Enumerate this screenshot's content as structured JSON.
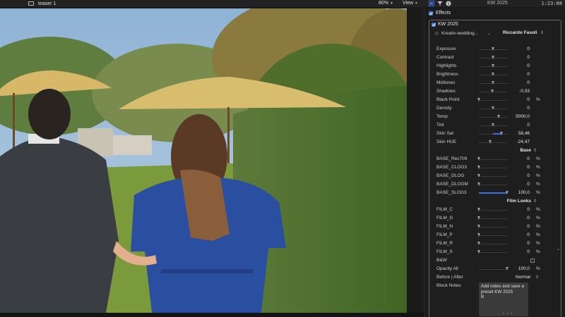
{
  "topbar": {
    "clip_title": "teaser 1",
    "zoom": "80%",
    "view_label": "View",
    "inspector_title": "KW 2025",
    "timecode": "1:23:08"
  },
  "inspector": {
    "section_label": "Effects",
    "effect_name": "KW 2025",
    "preset_name": "Kreativ-wedding...",
    "preset_author": "Riccardo Fasoli",
    "params_basic": [
      {
        "label": "Exposure",
        "value": "0",
        "unit": "",
        "pos": 0.5
      },
      {
        "label": "Contrast",
        "value": "0",
        "unit": "",
        "pos": 0.5
      },
      {
        "label": "Highlights",
        "value": "0",
        "unit": "",
        "pos": 0.5
      },
      {
        "label": "Brightness",
        "value": "0",
        "unit": "",
        "pos": 0.5
      },
      {
        "label": "Midtones",
        "value": "0",
        "unit": "",
        "pos": 0.5
      },
      {
        "label": "Shadows",
        "value": "-0,33",
        "unit": "",
        "pos": 0.48
      },
      {
        "label": "Black Point",
        "value": "0",
        "unit": "%",
        "pos": 0.0
      },
      {
        "label": "Density",
        "value": "0",
        "unit": "",
        "pos": 0.5
      },
      {
        "label": "Temp",
        "value": "5000,0",
        "unit": "",
        "pos": 0.7
      },
      {
        "label": "Tint",
        "value": "0",
        "unit": "",
        "pos": 0.5
      },
      {
        "label": "Skin Sat",
        "value": "58,46",
        "unit": "",
        "pos": 0.8,
        "fill": true
      },
      {
        "label": "Skin HUE",
        "value": "-24,47",
        "unit": "",
        "pos": 0.4
      }
    ],
    "base_section": "Base",
    "params_base": [
      {
        "label": "BASE_Rec709",
        "value": "0",
        "unit": "%",
        "pos": 0.0
      },
      {
        "label": "BASE_CLOG3",
        "value": "0",
        "unit": "%",
        "pos": 0.0
      },
      {
        "label": "BASE_DLOG",
        "value": "0",
        "unit": "%",
        "pos": 0.0
      },
      {
        "label": "BASE_DLOGM",
        "value": "0",
        "unit": "%",
        "pos": 0.0
      },
      {
        "label": "BASE_SLOG3",
        "value": "100,0",
        "unit": "%",
        "pos": 1.0,
        "fill": true
      }
    ],
    "film_section": "Film Looks",
    "params_film": [
      {
        "label": "FILM_C",
        "value": "0",
        "unit": "%",
        "pos": 0.0
      },
      {
        "label": "FILM_G",
        "value": "0",
        "unit": "%",
        "pos": 0.0
      },
      {
        "label": "FILM_N",
        "value": "0",
        "unit": "%",
        "pos": 0.0
      },
      {
        "label": "FILM_P",
        "value": "0",
        "unit": "%",
        "pos": 0.0
      },
      {
        "label": "FILM_R",
        "value": "0",
        "unit": "%",
        "pos": 0.0
      },
      {
        "label": "FILM_S",
        "value": "0",
        "unit": "%",
        "pos": 0.0
      }
    ],
    "bw_label": "B&W",
    "opacity": {
      "label": "Opacity All",
      "value": "100,0",
      "unit": "%",
      "pos": 1.0
    },
    "before_after": {
      "label": "Before | After",
      "value": "Normal"
    },
    "block_notes": {
      "label": "Block Notes",
      "text_line1": "Add notes and save a",
      "text_line2": "preset KW 2025",
      "text_line3": "B"
    }
  },
  "colors": {
    "accent": "#3b6fe6",
    "panel": "#1c1c1c"
  }
}
